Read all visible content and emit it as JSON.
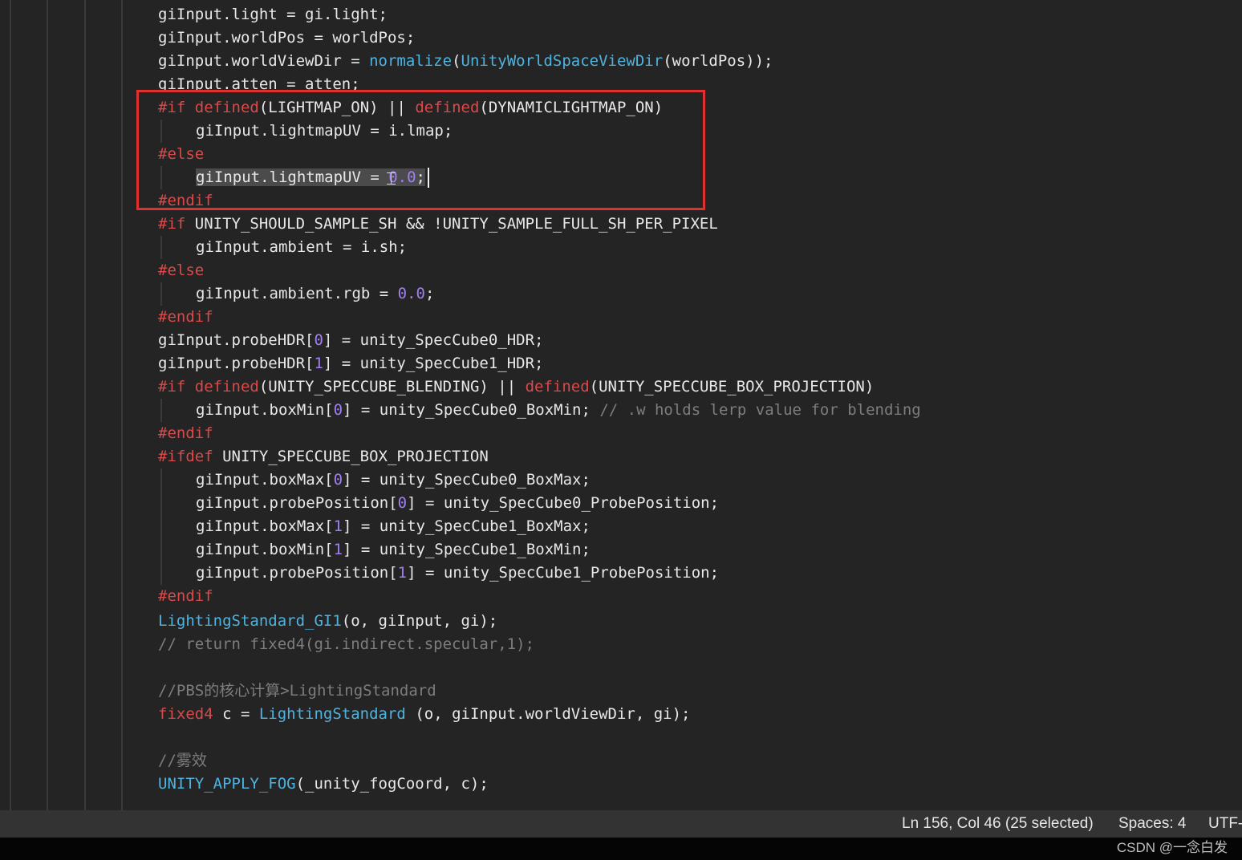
{
  "code": {
    "line01": "giInput.light = gi.light;",
    "line02": "giInput.worldPos = worldPos;",
    "line03_a": "giInput.worldViewDir = ",
    "line03_fn1": "normalize",
    "line03_b": "(",
    "line03_fn2": "UnityWorldSpaceViewDir",
    "line03_c": "(worldPos));",
    "line04": "giInput.atten = atten;",
    "line05_dir": "#if",
    "line05_kw1": "defined",
    "line05_a": "(LIGHTMAP_ON) || ",
    "line05_kw2": "defined",
    "line05_b": "(DYNAMICLIGHTMAP_ON)",
    "line06": "giInput.lightmapUV = i.lmap;",
    "line07_dir": "#else",
    "line08_sel": "giInput.lightmapUV = ",
    "line08_num": "0.0",
    "line08_end": ";",
    "line09_dir": "#endif",
    "line10_dir": "#if",
    "line10_a": " UNITY_SHOULD_SAMPLE_SH && !UNITY_SAMPLE_FULL_SH_PER_PIXEL",
    "line11": "giInput.ambient = i.sh;",
    "line12_dir": "#else",
    "line13_a": "giInput.ambient.rgb = ",
    "line13_num": "0.0",
    "line13_b": ";",
    "line14_dir": "#endif",
    "line15_a": "giInput.probeHDR[",
    "line15_num": "0",
    "line15_b": "] = unity_SpecCube0_HDR;",
    "line16_a": "giInput.probeHDR[",
    "line16_num": "1",
    "line16_b": "] = unity_SpecCube1_HDR;",
    "line17_dir": "#if",
    "line17_kw1": "defined",
    "line17_a": "(UNITY_SPECCUBE_BLENDING) || ",
    "line17_kw2": "defined",
    "line17_b": "(UNITY_SPECCUBE_BOX_PROJECTION)",
    "line18_a": "giInput.boxMin[",
    "line18_num": "0",
    "line18_b": "] = unity_SpecCube0_BoxMin; ",
    "line18_com": "// .w holds lerp value for blending",
    "line19_dir": "#endif",
    "line20_dir": "#ifdef",
    "line20_a": " UNITY_SPECCUBE_BOX_PROJECTION",
    "line21_a": "giInput.boxMax[",
    "line21_num": "0",
    "line21_b": "] = unity_SpecCube0_BoxMax;",
    "line22_a": "giInput.probePosition[",
    "line22_num": "0",
    "line22_b": "] = unity_SpecCube0_ProbePosition;",
    "line23_a": "giInput.boxMax[",
    "line23_num": "1",
    "line23_b": "] = unity_SpecCube1_BoxMax;",
    "line24_a": "giInput.boxMin[",
    "line24_num": "1",
    "line24_b": "] = unity_SpecCube1_BoxMin;",
    "line25_a": "giInput.probePosition[",
    "line25_num": "1",
    "line25_b": "] = unity_SpecCube1_ProbePosition;",
    "line26_dir": "#endif",
    "line27_fn": "LightingStandard_GI1",
    "line27_a": "(o, giInput, gi);",
    "line28_com": "// return fixed4(gi.indirect.specular,1);",
    "line29_com": "//PBS的核心计算>LightingStandard",
    "line30_type": "fixed4",
    "line30_a": " c = ",
    "line30_fn": "LightingStandard",
    "line30_b": " (o, giInput.worldViewDir, gi);",
    "line31_com": "//雾效",
    "line32_fn": "UNITY_APPLY_FOG",
    "line32_a": "(_unity_fogCoord, c);"
  },
  "status_bar": {
    "cursor_position": "Ln 156, Col 46 (25 selected)",
    "indentation": "Spaces: 4",
    "encoding": "UTF-"
  },
  "watermark": "CSDN @一念白发",
  "colors": {
    "background": "#242424",
    "preprocessor": "#d94a4a",
    "function": "#4fb3e0",
    "number": "#a07ff0",
    "comment": "#7d7d7d",
    "annotation_box": "#e03131"
  }
}
